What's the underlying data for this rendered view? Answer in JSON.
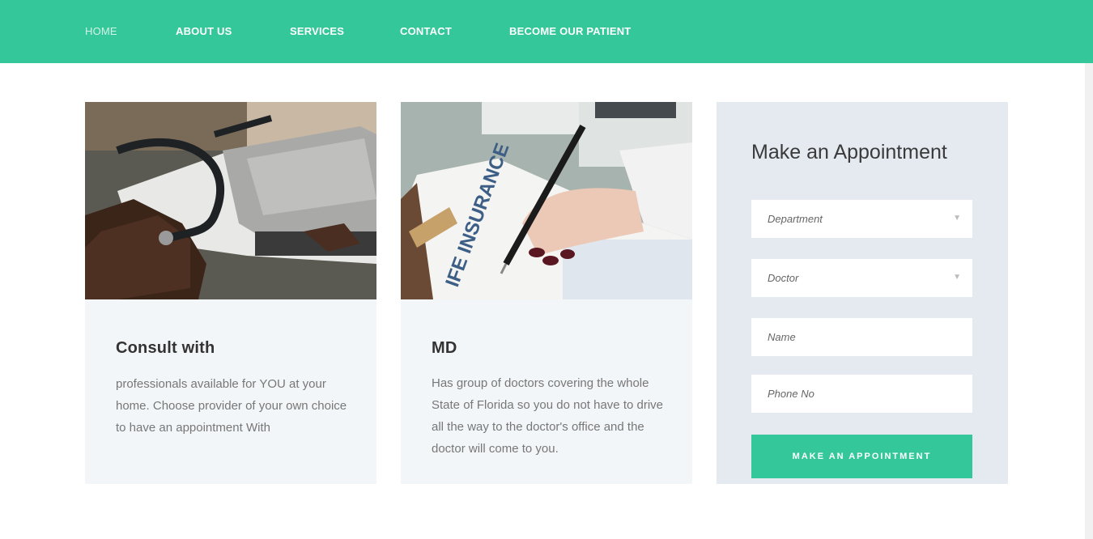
{
  "nav": {
    "items": [
      {
        "label": "HOME"
      },
      {
        "label": "ABOUT US"
      },
      {
        "label": "SERVICES"
      },
      {
        "label": "CONTACT"
      },
      {
        "label": "BECOME OUR PATIENT"
      }
    ],
    "accent_color": "#34c79a"
  },
  "cards": [
    {
      "image_icon": "blood-pressure-cuff-photo",
      "title": "Consult with",
      "text": "professionals available for YOU at your home. Choose provider of your own choice to have an appointment With"
    },
    {
      "image_icon": "insurance-form-photo",
      "title": "MD",
      "text": "Has group of doctors covering the whole State of Florida so you do not have to drive all the way to the doctor's office and the doctor will come to you."
    }
  ],
  "appointment": {
    "title": "Make an Appointment",
    "department_placeholder": "Department",
    "doctor_placeholder": "Doctor",
    "name_placeholder": "Name",
    "phone_placeholder": "Phone No",
    "button_label": "MAKE AN APPOINTMENT"
  }
}
